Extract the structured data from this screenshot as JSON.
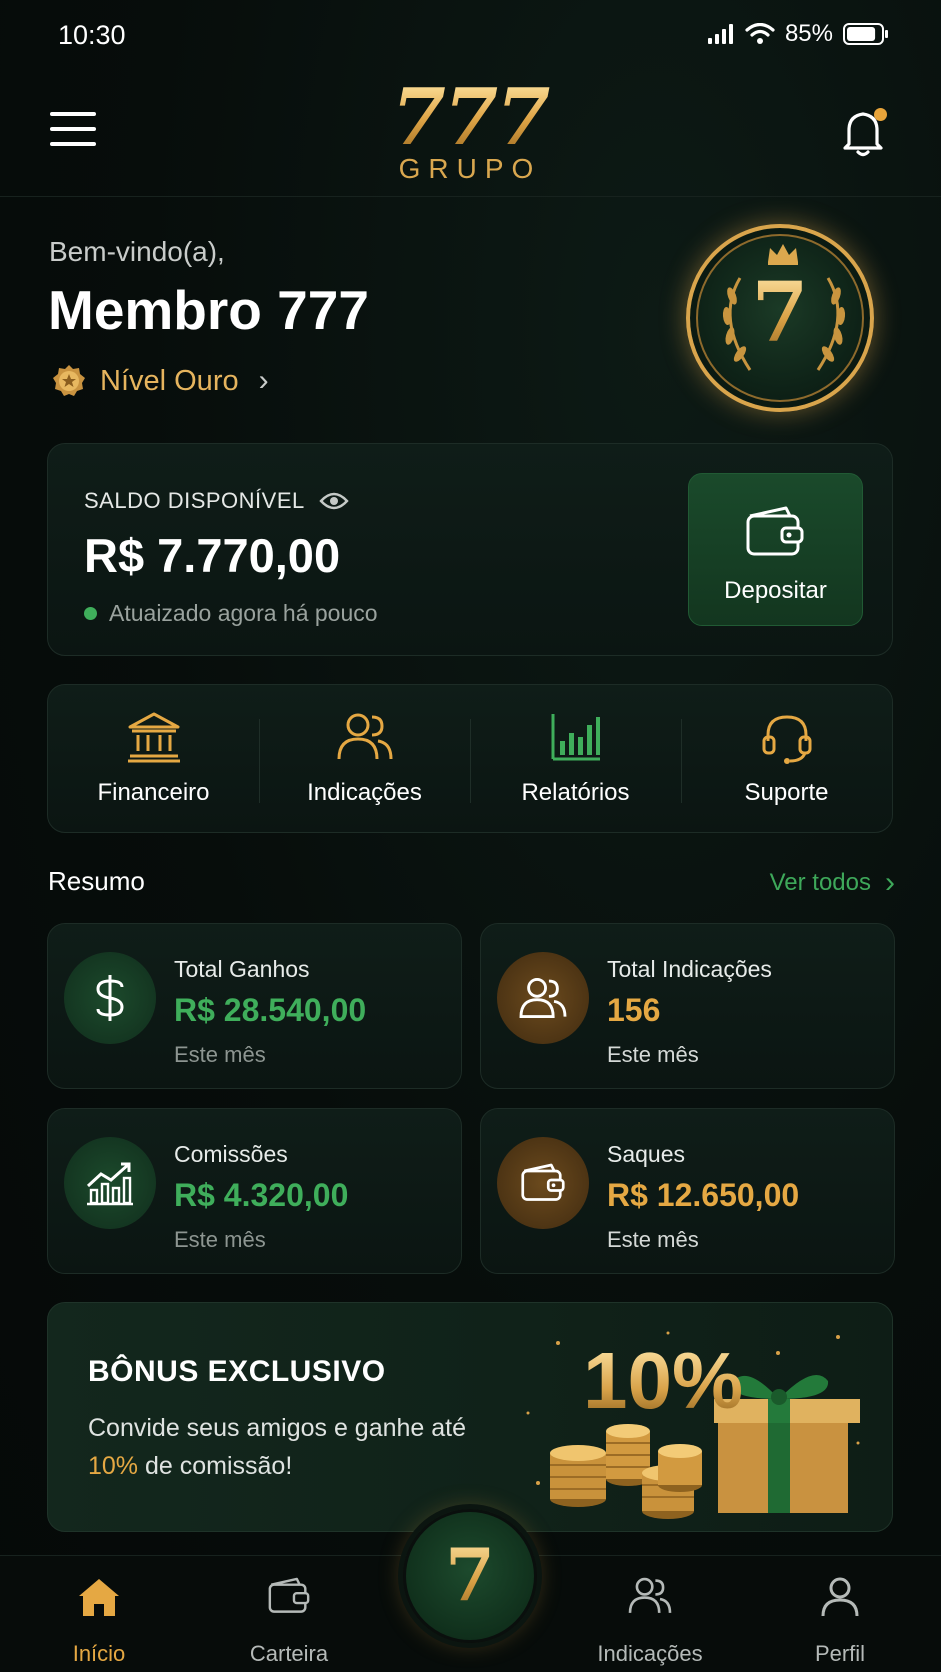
{
  "status_bar": {
    "time": "10:30",
    "battery": "85%",
    "battery_level": 0.85
  },
  "header": {
    "logo_number": "777",
    "logo_word": "GRUPO"
  },
  "welcome": {
    "greeting": "Bem-vindo(a),",
    "name": "Membro 777",
    "level": "Nível Ouro",
    "badge_number": "7"
  },
  "balance": {
    "label": "SALDO DISPONÍVEL",
    "value": "R$ 7.770,00",
    "updated": "Atuaizado agora há pouco",
    "deposit_label": "Depositar"
  },
  "quick_actions": [
    {
      "label": "Financeiro",
      "icon": "bank-icon"
    },
    {
      "label": "Indicações",
      "icon": "users-icon"
    },
    {
      "label": "Relatórios",
      "icon": "bar-chart-icon"
    },
    {
      "label": "Suporte",
      "icon": "headset-icon"
    }
  ],
  "summary": {
    "title": "Resumo",
    "see_all": "Ver todos",
    "cards": [
      {
        "title": "Total Ganhos",
        "value": "R$ 28.540,00",
        "sub": "Este mês",
        "icon": "dollar-icon",
        "accent": "#3fae5b"
      },
      {
        "title": "Total Indicações",
        "value": "156",
        "sub": "Este mês",
        "icon": "users-icon",
        "accent": "#e5a843"
      },
      {
        "title": "Comissões",
        "value": "R$ 4.320,00",
        "sub": "Este mês",
        "icon": "trend-chart-icon",
        "accent": "#3fae5b"
      },
      {
        "title": "Saques",
        "value": "R$ 12.650,00",
        "sub": "Este mês",
        "icon": "wallet-icon",
        "accent": "#e5a843"
      }
    ]
  },
  "bonus": {
    "title": "BÔNUS EXCLUSIVO",
    "text_pre": "Convide seus amigos e ganhe até ",
    "text_highlight": "10%",
    "text_post": " de comissão!",
    "percent": "10%"
  },
  "nav": {
    "items": [
      {
        "label": "Início",
        "icon": "home-icon",
        "active": true
      },
      {
        "label": "Carteira",
        "icon": "wallet-icon",
        "active": false
      },
      {
        "label": "Indicações",
        "icon": "users-icon",
        "active": false
      },
      {
        "label": "Perfil",
        "icon": "user-icon",
        "active": false
      }
    ],
    "center_label": "7"
  },
  "colors": {
    "accent_gold": "#e5a843",
    "accent_green": "#3fae5b",
    "background": "#07100d"
  }
}
